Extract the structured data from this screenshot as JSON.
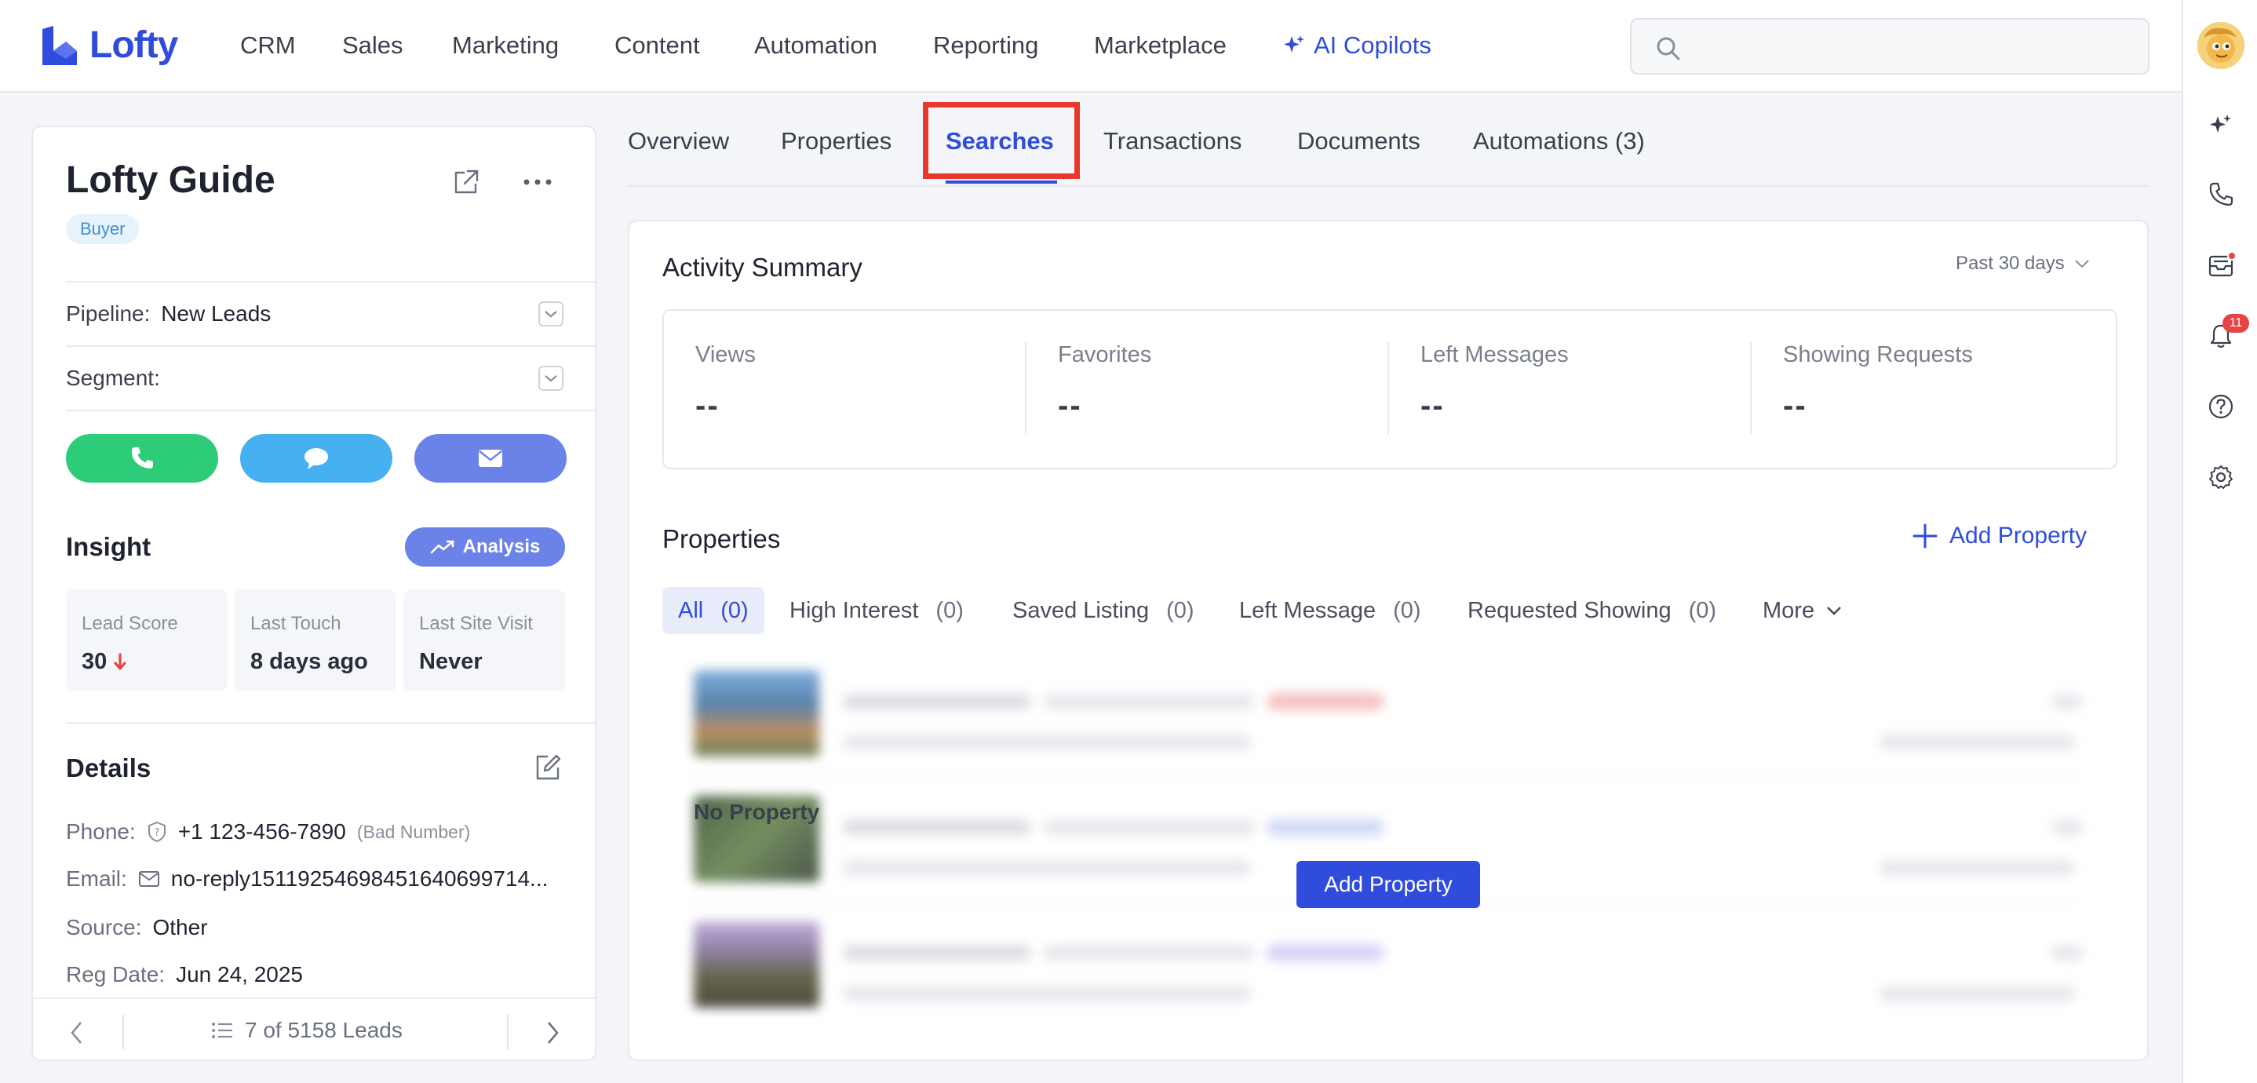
{
  "app": {
    "logo_text": "Lofty",
    "brand_color": "#2f4cdd"
  },
  "nav": {
    "items": [
      "CRM",
      "Sales",
      "Marketing",
      "Content",
      "Automation",
      "Reporting",
      "Marketplace"
    ],
    "ai_label": "AI Copilots",
    "search_placeholder": ""
  },
  "rail": {
    "icons": [
      "avatar",
      "sparkle-icon",
      "phone-icon",
      "inbox-icon",
      "bell-icon",
      "help-icon",
      "gear-icon"
    ],
    "notification_count": "11"
  },
  "lead": {
    "name": "Lofty Guide",
    "tag": "Buyer",
    "pipeline_label": "Pipeline:",
    "pipeline_value": "New Leads",
    "segment_label": "Segment:",
    "segment_value": "",
    "action_colors": {
      "call": "#2dcc78",
      "text": "#45b1f0",
      "email": "#6b82e8"
    }
  },
  "insight": {
    "title": "Insight",
    "analysis_label": "Analysis",
    "metrics": [
      {
        "label": "Lead Score",
        "value": "30",
        "trend": "down"
      },
      {
        "label": "Last Touch",
        "value": "8 days ago"
      },
      {
        "label": "Last Site Visit",
        "value": "Never"
      }
    ]
  },
  "details": {
    "title": "Details",
    "phone_label": "Phone:",
    "phone_value": "+1 123-456-7890",
    "phone_note": "(Bad Number)",
    "email_label": "Email:",
    "email_value": "no-reply15119254698451640699714...",
    "source_label": "Source:",
    "source_value": "Other",
    "reg_label": "Reg Date:",
    "reg_value": "Jun 24, 2025"
  },
  "pager": {
    "text": "7 of 5158 Leads"
  },
  "tabs": {
    "items": [
      "Overview",
      "Properties",
      "Searches",
      "Transactions",
      "Documents",
      "Automations (3)"
    ],
    "active": "Searches"
  },
  "activity": {
    "title": "Activity Summary",
    "range": "Past 30 days",
    "stats": [
      {
        "label": "Views",
        "value": "--"
      },
      {
        "label": "Favorites",
        "value": "--"
      },
      {
        "label": "Left Messages",
        "value": "--"
      },
      {
        "label": "Showing Requests",
        "value": "--"
      }
    ]
  },
  "properties": {
    "title": "Properties",
    "add_label": "Add Property",
    "filters": [
      {
        "label": "All",
        "count": "(0)"
      },
      {
        "label": "High Interest",
        "count": "(0)"
      },
      {
        "label": "Saved Listing",
        "count": "(0)"
      },
      {
        "label": "Left Message",
        "count": "(0)"
      },
      {
        "label": "Requested Showing",
        "count": "(0)"
      }
    ],
    "more_label": "More",
    "empty_title": "No Property",
    "empty_button": "Add Property"
  }
}
